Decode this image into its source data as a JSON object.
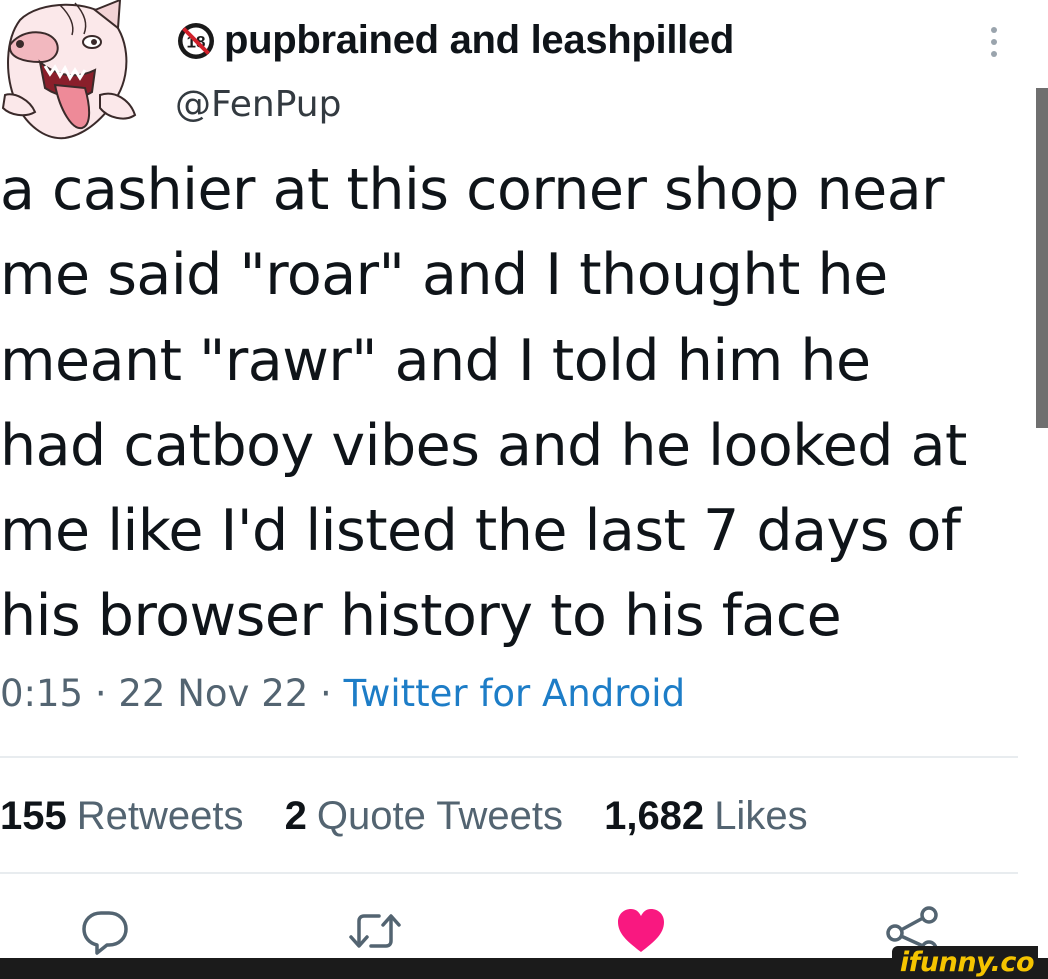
{
  "tweet": {
    "author": {
      "display_name": "pupbrained and leashpilled",
      "handle": "@FenPup",
      "badge_text": "18"
    },
    "text": "a cashier at this corner shop near\nme said \"roar\" and I thought he\nmeant \"rawr\" and I told him he\nhad catboy vibes and he looked at\nme like I'd listed the last 7 days of\nhis browser history to his face",
    "time": "0:15",
    "separator": " · ",
    "date": "22 Nov 22",
    "source": "Twitter for Android",
    "stats": {
      "retweets_count": "155",
      "retweets_label": "Retweets",
      "quote_count": "2",
      "quote_label": "Quote Tweets",
      "likes_count": "1,682",
      "likes_label": "Likes"
    },
    "actions": {
      "reply": "reply-icon",
      "retweet": "retweet-icon",
      "like": "heart-icon",
      "share": "share-icon"
    },
    "colors": {
      "link": "#1d7dc7",
      "like": "#f91880",
      "text": "#0f1419",
      "secondary": "#536471"
    }
  },
  "watermark": "ifunny.co"
}
